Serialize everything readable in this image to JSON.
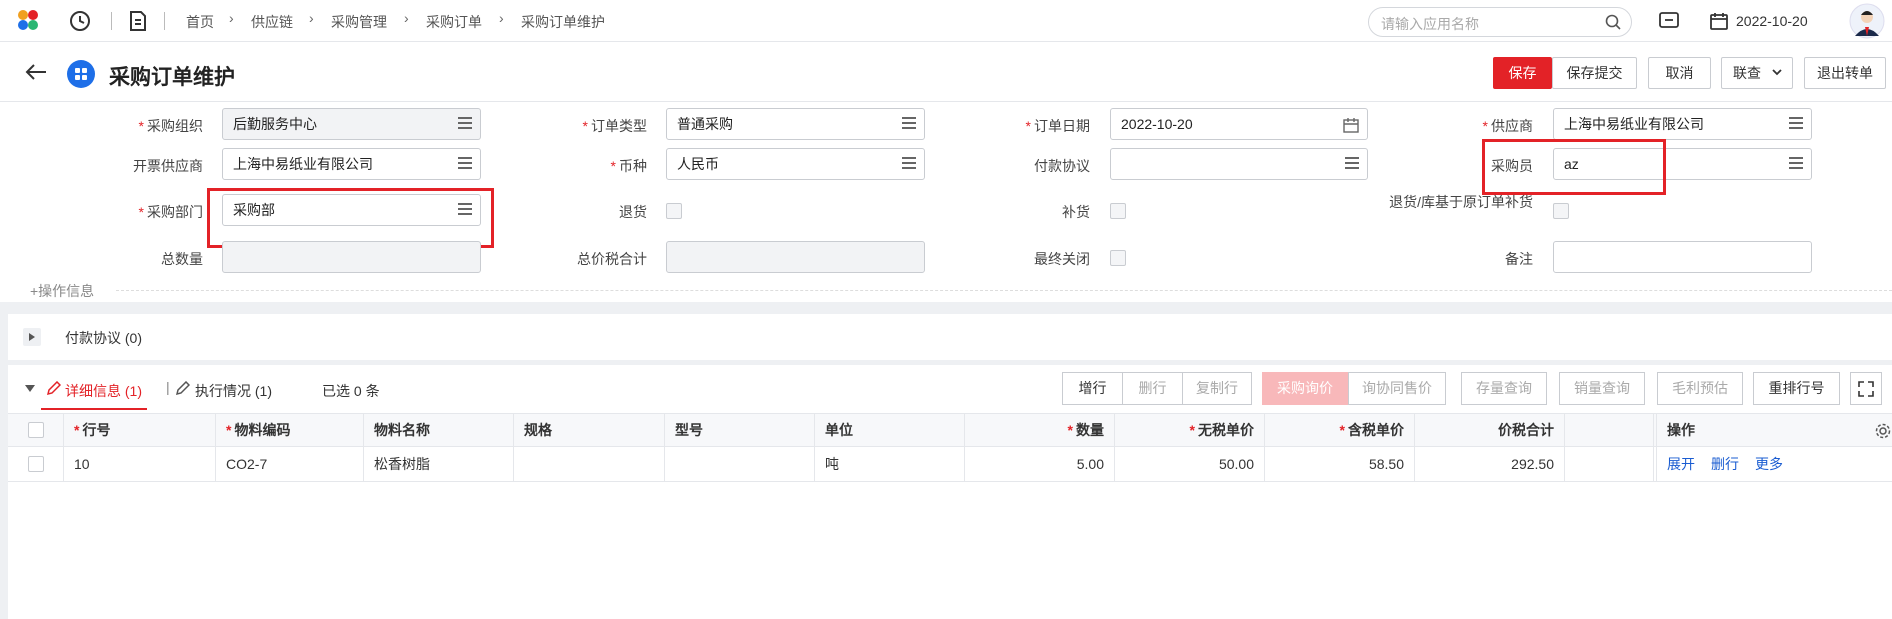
{
  "breadcrumb": [
    "首页",
    "供应链",
    "采购管理",
    "采购订单",
    "采购订单维护"
  ],
  "search": {
    "placeholder": "请输入应用名称"
  },
  "topbar": {
    "date": "2022-10-20"
  },
  "page": {
    "title": "采购订单维护"
  },
  "actions": {
    "save": "保存",
    "save_submit": "保存提交",
    "cancel": "取消",
    "linked_query": "联查",
    "exit": "退出转单"
  },
  "form": {
    "org_label": "采购组织",
    "org_value": "后勤服务中心",
    "order_type_label": "订单类型",
    "order_type_value": "普通采购",
    "order_date_label": "订单日期",
    "order_date_value": "2022-10-20",
    "supplier_label": "供应商",
    "supplier_value": "上海中易纸业有限公司",
    "invoice_supplier_label": "开票供应商",
    "invoice_supplier_value": "上海中易纸业有限公司",
    "currency_label": "币种",
    "currency_value": "人民币",
    "payment_agreement_label": "付款协议",
    "payment_agreement_value": "",
    "buyer_label": "采购员",
    "buyer_value": "az",
    "dept_label": "采购部门",
    "dept_value": "采购部",
    "return_label": "退货",
    "replenish_label": "补货",
    "return_based_label": "退货/库基于原订单补货",
    "total_qty_label": "总数量",
    "total_tax_label": "总价税合计",
    "final_close_label": "最终关闭",
    "remark_label": "备注",
    "op_info": "+操作信息"
  },
  "payment_section": {
    "title": "付款协议 (0)"
  },
  "detail": {
    "tab_detail": "详细信息 (1)",
    "tab_exec": "执行情况 (1)",
    "selected": "已选 0 条",
    "buttons": {
      "add_row": "增行",
      "delete_row": "删行",
      "copy_row": "复制行",
      "purchase_inquiry": "采购询价",
      "inquiry_sales_price": "询协同售价",
      "stock_query": "存量查询",
      "sales_query": "销量查询",
      "margin_estimate": "毛利预估",
      "renumber": "重排行号"
    },
    "columns": {
      "row_no": "行号",
      "material_code": "物料编码",
      "material_name": "物料名称",
      "spec": "规格",
      "model": "型号",
      "unit": "单位",
      "qty": "数量",
      "price_no_tax": "无税单价",
      "price_with_tax": "含税单价",
      "total_with_tax": "价税合计",
      "ops": "操作"
    },
    "rows": [
      {
        "row_no": "10",
        "material_code": "CO2-7",
        "material_name": "松香树脂",
        "spec": "",
        "model": "",
        "unit": "吨",
        "qty": "5.00",
        "price_no_tax": "50.00",
        "price_with_tax": "58.50",
        "total_with_tax": "292.50",
        "op_expand": "展开",
        "op_delete": "删行",
        "op_more": "更多"
      }
    ]
  },
  "colors": {
    "accent": "#e32227",
    "link": "#1a5cd1",
    "brand_blue": "#1e6fe8"
  }
}
